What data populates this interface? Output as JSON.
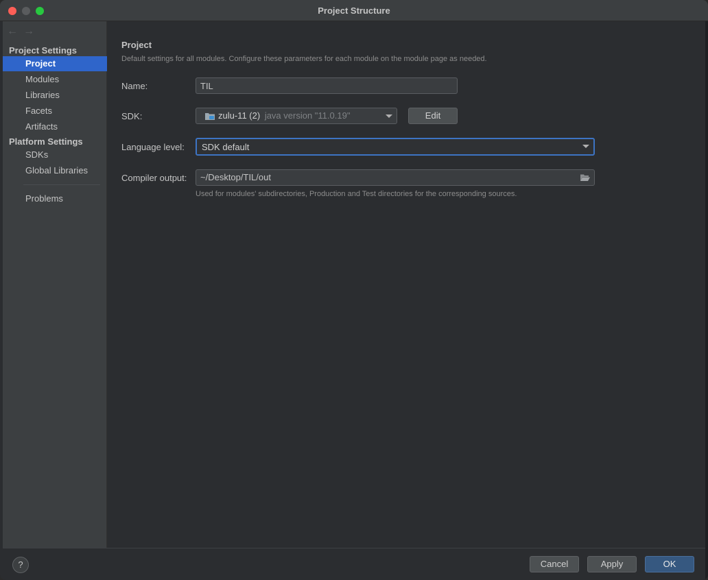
{
  "window": {
    "title": "Project Structure"
  },
  "sidebar": {
    "back_icon": "arrow-left-icon",
    "forward_icon": "arrow-right-icon",
    "project_settings_heading": "Project Settings",
    "project_items": [
      {
        "label": "Project",
        "selected": true
      },
      {
        "label": "Modules"
      },
      {
        "label": "Libraries"
      },
      {
        "label": "Facets"
      },
      {
        "label": "Artifacts"
      }
    ],
    "platform_settings_heading": "Platform Settings",
    "platform_items": [
      {
        "label": "SDKs"
      },
      {
        "label": "Global Libraries"
      }
    ],
    "problems_label": "Problems"
  },
  "main": {
    "title": "Project",
    "description": "Default settings for all modules. Configure these parameters for each module on the module page as needed.",
    "name_label": "Name:",
    "name_value": "TIL",
    "sdk_label": "SDK:",
    "sdk_icon": "folder-sdk-icon",
    "sdk_name": "zulu-11 (2)",
    "sdk_version": "java version \"11.0.19\"",
    "edit_label": "Edit",
    "language_level_label": "Language level:",
    "language_level_value": "SDK default",
    "compiler_output_label": "Compiler output:",
    "compiler_output_value": "~/Desktop/TIL/out",
    "browse_icon": "folder-open-icon",
    "compiler_output_hint": "Used for modules' subdirectories, Production and Test directories for the corresponding sources."
  },
  "footer": {
    "help_label": "?",
    "cancel_label": "Cancel",
    "apply_label": "Apply",
    "ok_label": "OK"
  },
  "colors": {
    "selection": "#2f65ca",
    "primary_button": "#365880",
    "focus_ring": "#3d74c4"
  }
}
